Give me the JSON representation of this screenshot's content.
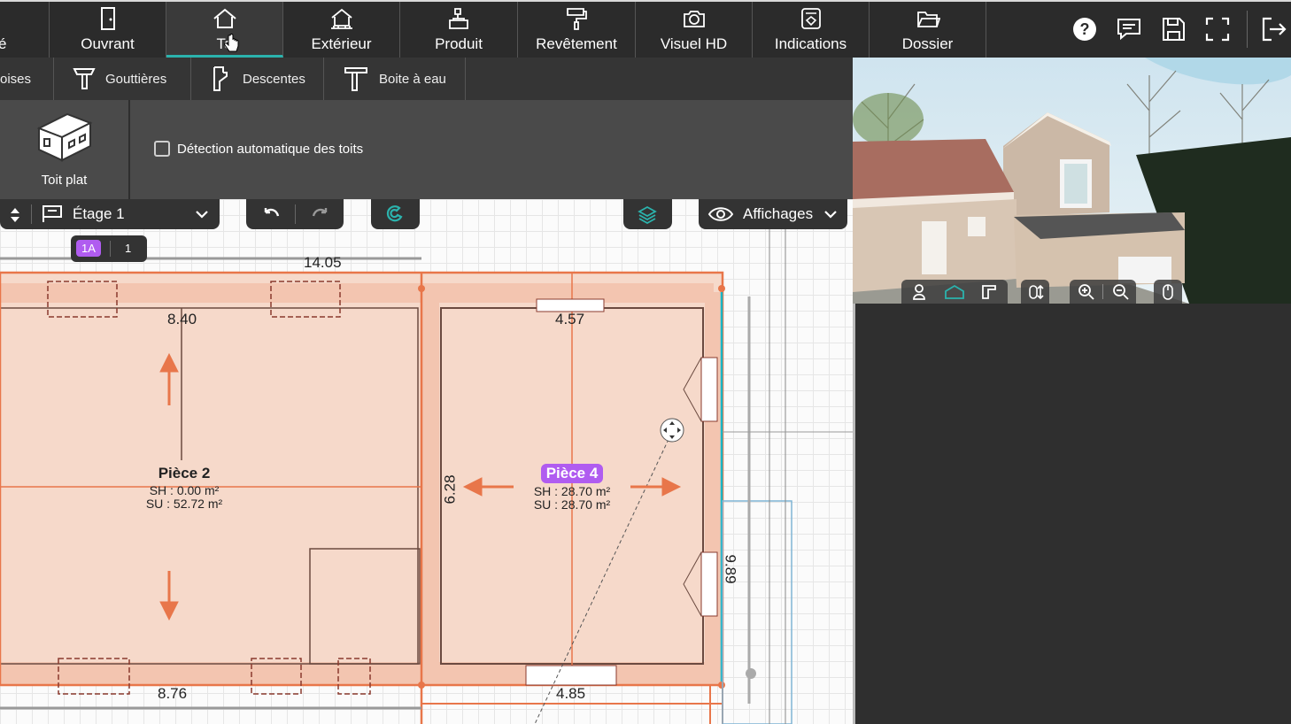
{
  "topbar": {
    "partial_tab": "é",
    "tabs": [
      {
        "label": "Ouvrant",
        "icon": "door-icon"
      },
      {
        "label": "To",
        "icon": "roof-icon"
      },
      {
        "label": "Extérieur",
        "icon": "exterior-icon"
      },
      {
        "label": "Produit",
        "icon": "product-icon"
      },
      {
        "label": "Revêtement",
        "icon": "paint-roller-icon"
      },
      {
        "label": "Visuel HD",
        "icon": "camera-icon"
      },
      {
        "label": "Indications",
        "icon": "indications-icon"
      },
      {
        "label": "Dossier",
        "icon": "folder-icon"
      }
    ],
    "tools": [
      "help-icon",
      "comment-icon",
      "save-icon",
      "fullscreen-icon",
      "logout-icon"
    ]
  },
  "subbar": {
    "partial": "oises",
    "items": [
      {
        "label": "Gouttières",
        "icon": "gutter-icon"
      },
      {
        "label": "Descentes",
        "icon": "downspout-icon"
      },
      {
        "label": "Boite à eau",
        "icon": "water-box-icon"
      }
    ]
  },
  "panel": {
    "toit_plat": "Toit plat",
    "checkbox_label": "Détection automatique des toits",
    "checkbox_checked": false
  },
  "plan_toolbar": {
    "floor": "Étage 1",
    "display": "Affichages",
    "layer_badge": "1A",
    "layer_num": "1"
  },
  "plan": {
    "dims": {
      "top": "14.05",
      "left_room": "8.40",
      "right_room_top": "4.57",
      "right_room_height": "6.28",
      "right_side": "9.89",
      "bottom_left": "8.76",
      "bottom_right": "4.85"
    },
    "rooms": [
      {
        "name": "Pièce 2",
        "sh": "SH : 0.00 m²",
        "su": "SU : 52.72 m²"
      },
      {
        "name": "Pièce 4",
        "sh": "SH : 28.70 m²",
        "su": "SU : 28.70 m²"
      }
    ]
  },
  "colors": {
    "accent": "#2bb3ad",
    "wall": "#e8764a",
    "room_fill": "#f7dccf",
    "selected_label": "#b05cf0"
  }
}
